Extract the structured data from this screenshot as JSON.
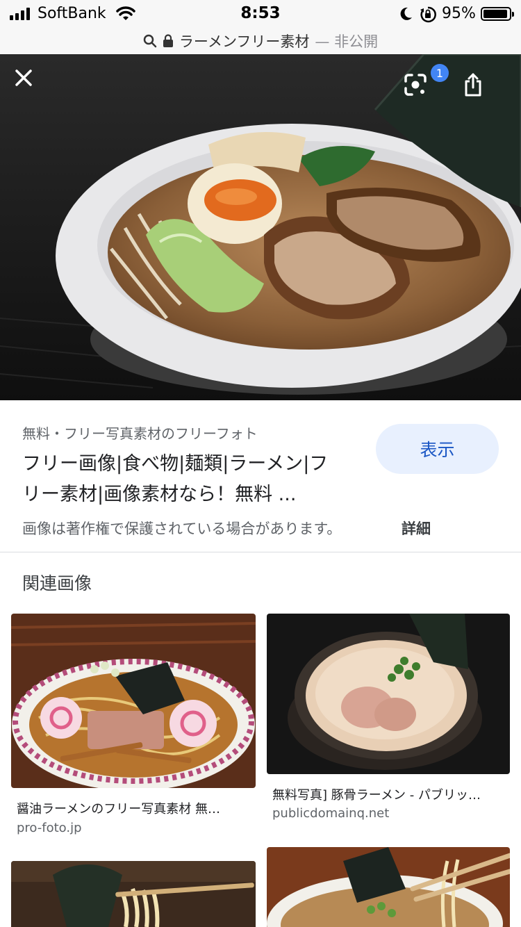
{
  "status_bar": {
    "carrier": "SoftBank",
    "time": "8:53",
    "battery_percent": "95%",
    "battery_level": 0.95
  },
  "url_bar": {
    "title": "ラーメンフリー素材",
    "suffix": "— 非公開"
  },
  "viewer": {
    "lens_badge": "1",
    "source": "無料・フリー写真素材のフリーフォト",
    "title_line1": "フリー画像|食べ物|麺類|ラーメン|フ",
    "title_line2": "リー素材|画像素材なら！無料 ...",
    "visit_label": "表示",
    "copyright_notice": "画像は著作権で保護されている場合があります。",
    "details_label": "詳細"
  },
  "related": {
    "heading": "関連画像",
    "items": [
      {
        "title": "醤油ラーメンのフリー写真素材 無…",
        "domain": "pro-foto.jp"
      },
      {
        "title": "無料写真] 豚骨ラーメン - パブリッ…",
        "domain": "publicdomainq.net"
      }
    ]
  },
  "colors": {
    "accent": "#1a56c4",
    "button_bg": "#e8f0fe",
    "badge": "#4285f4"
  },
  "icons": [
    "signal-icon",
    "wifi-icon",
    "moon-icon",
    "rotation-lock-icon",
    "battery-icon",
    "search-icon",
    "lock-icon",
    "close-icon",
    "lens-icon",
    "share-icon"
  ]
}
